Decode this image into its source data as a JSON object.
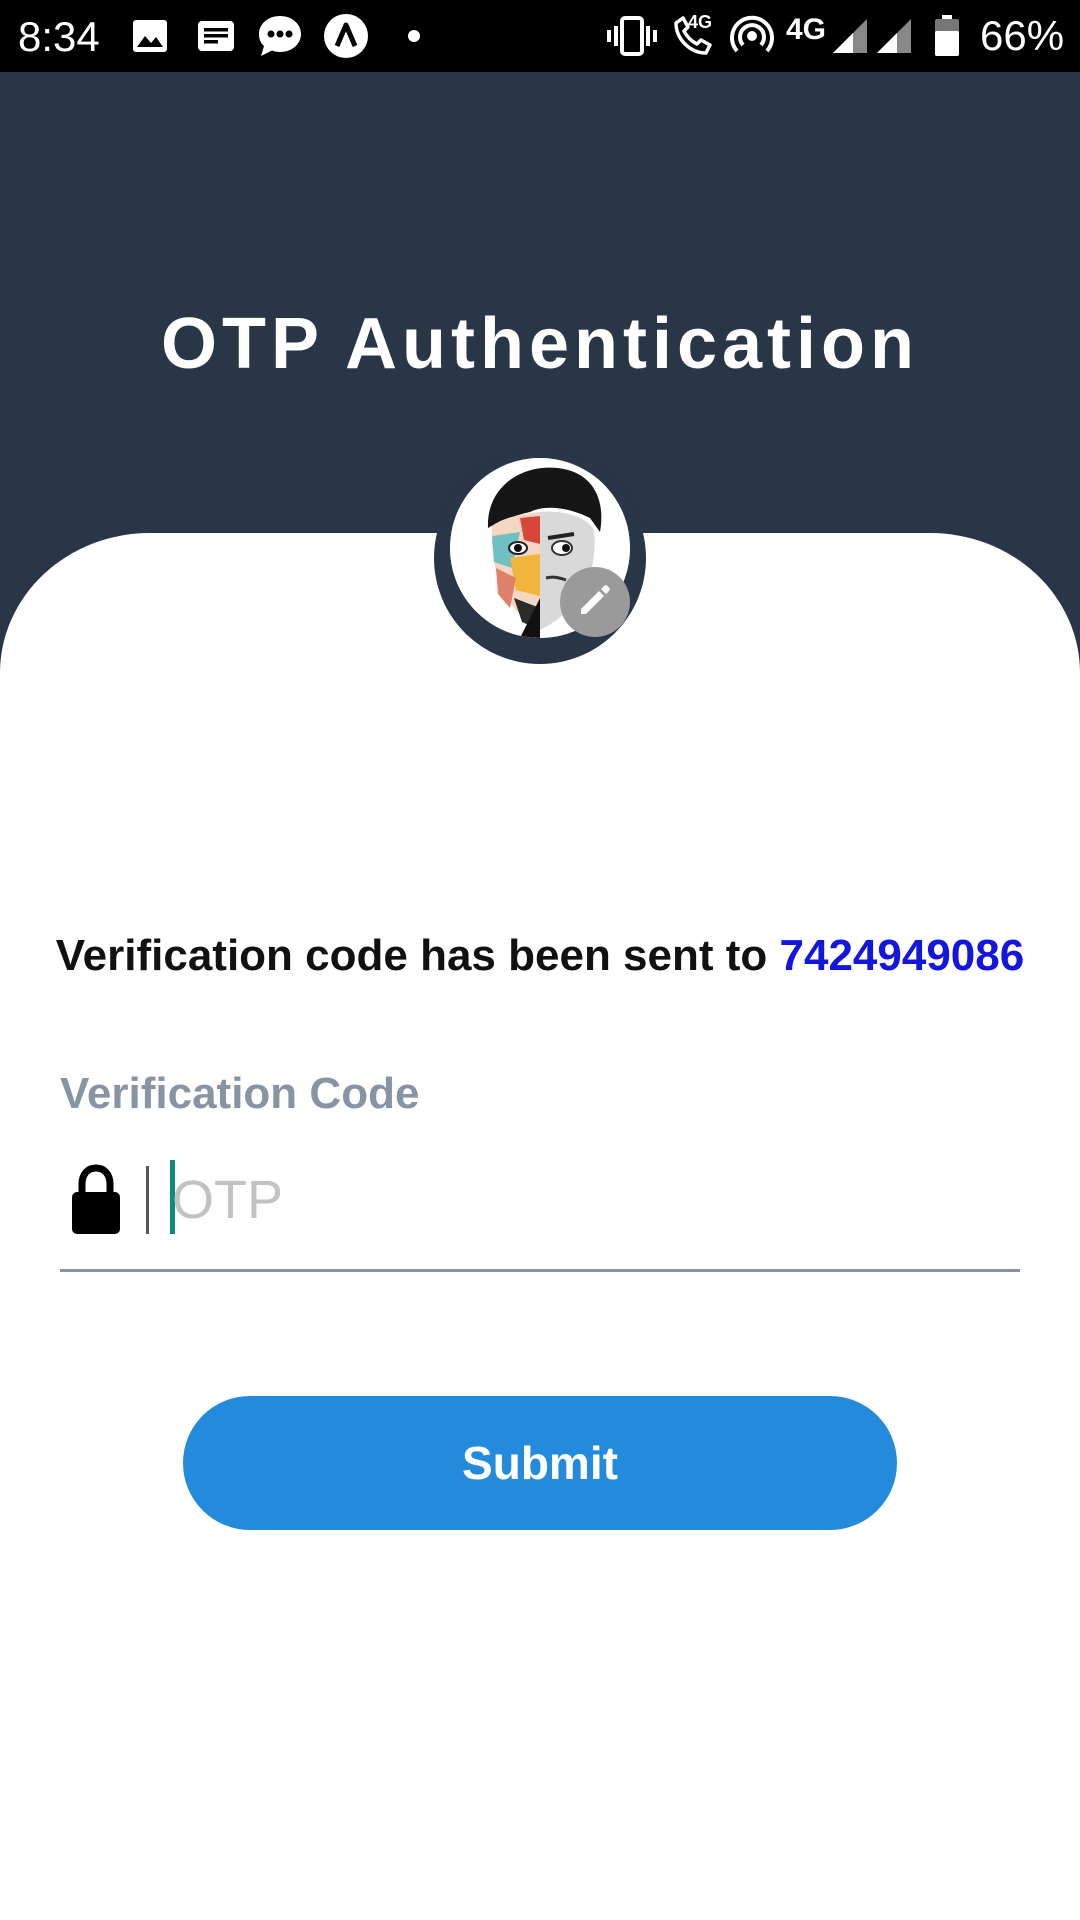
{
  "status_bar": {
    "time": "8:34",
    "network_label": "4G",
    "call_network_label": "4G",
    "battery_percent": "66%",
    "icons": [
      "image-icon",
      "news-icon",
      "messages-icon",
      "app-icon",
      "dot-icon",
      "vibrate-icon",
      "volte-call-icon",
      "hotspot-icon",
      "signal-icon",
      "signal-icon",
      "battery-icon"
    ]
  },
  "header": {
    "title": "OTP Authentication",
    "background_color": "#283648"
  },
  "avatar": {
    "edit_icon": "pencil-icon"
  },
  "message": {
    "text": "Verification code has been sent to",
    "phone": "7424949086",
    "phone_color": "#1515e0"
  },
  "otp_field": {
    "label": "Verification Code",
    "placeholder": "OTP",
    "value": "",
    "icon": "lock-icon"
  },
  "submit": {
    "label": "Submit",
    "color": "#238adc"
  }
}
